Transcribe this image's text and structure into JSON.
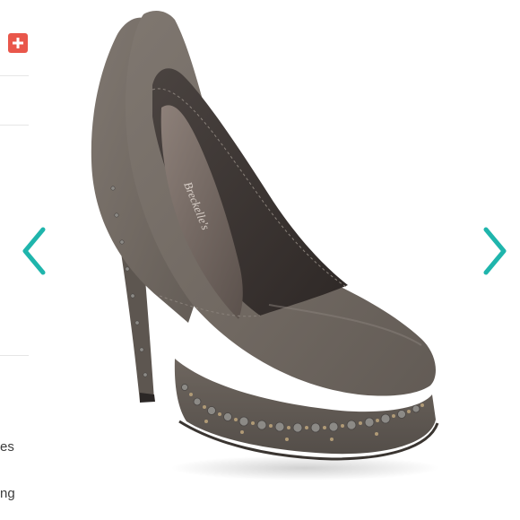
{
  "sidebar": {
    "add_icon": "plus-icon",
    "texts": [
      "es",
      "ng"
    ]
  },
  "carousel": {
    "prev_icon": "chevron-left-icon",
    "next_icon": "chevron-right-icon",
    "accent_color": "#1fb5ac"
  },
  "product_image": {
    "insole_brand": "Breckelle's"
  },
  "colors": {
    "add_button": "#e9574b",
    "suede": "#726a63",
    "studs": "#8c8a86"
  }
}
